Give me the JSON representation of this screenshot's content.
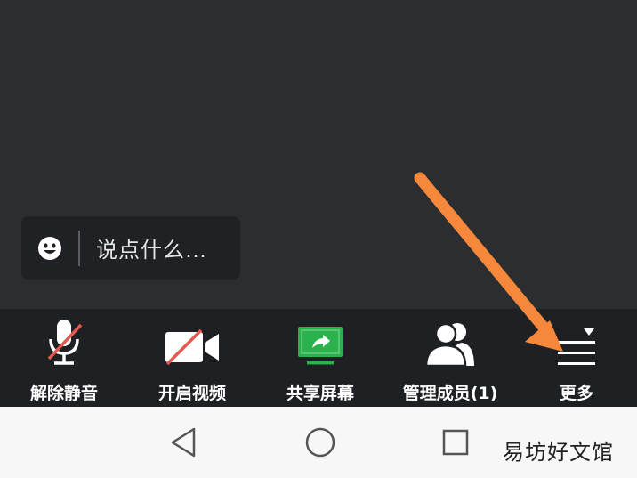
{
  "chat": {
    "placeholder": "说点什么…"
  },
  "toolbar": {
    "items": [
      {
        "label": "解除静音",
        "icon": "microphone-muted-icon"
      },
      {
        "label": "开启视频",
        "icon": "video-off-icon"
      },
      {
        "label": "共享屏幕",
        "icon": "share-screen-icon"
      },
      {
        "label": "管理成员(1)",
        "icon": "members-icon"
      },
      {
        "label": "更多",
        "icon": "more-menu-icon"
      }
    ]
  },
  "navbar": {
    "icons": [
      "back-icon",
      "home-icon",
      "recents-icon"
    ]
  },
  "watermark": {
    "text": "易坊好文馆"
  },
  "colors": {
    "accent_green": "#2bb24c",
    "mute_red": "#e05a4f",
    "arrow_orange": "#f5883a"
  }
}
